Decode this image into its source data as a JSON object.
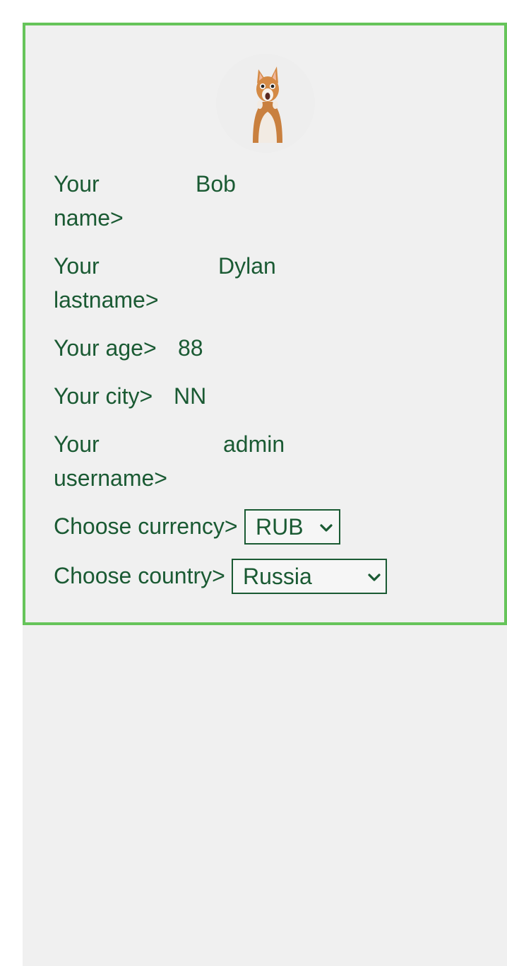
{
  "profile": {
    "avatar_icon": "shocked-cat-avatar",
    "fields": {
      "name": {
        "label_line1": "Your",
        "label_line2": "name>",
        "value": "Bob"
      },
      "lastname": {
        "label_line1": "Your",
        "label_line2": "lastname>",
        "value": "Dylan"
      },
      "age": {
        "label": "Your age>",
        "value": "88"
      },
      "city": {
        "label": "Your city>",
        "value": "NN"
      },
      "username": {
        "label_line1": "Your",
        "label_line2": "username>",
        "value": "admin"
      }
    },
    "currency": {
      "label": "Choose currency>",
      "selected": "RUB",
      "icon": "chevron-down-icon"
    },
    "country": {
      "label": "Choose country>",
      "selected": "Russia",
      "icon": "chevron-down-icon"
    }
  },
  "colors": {
    "card_border": "#66c45a",
    "text": "#1a5a33",
    "background": "#f0f0f0"
  }
}
